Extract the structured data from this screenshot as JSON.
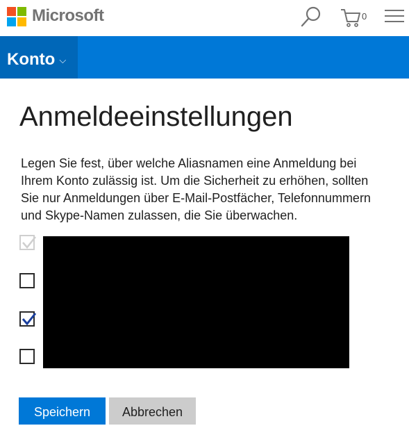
{
  "header": {
    "brand": "Microsoft",
    "cart_count": "0",
    "icons": {
      "search": "search-icon",
      "cart": "cart-icon",
      "menu": "hamburger-menu-icon"
    }
  },
  "nav": {
    "account_label": "Konto",
    "account_chevron": "⌵"
  },
  "main": {
    "title": "Anmeldeeinstellungen",
    "description": "Legen Sie fest, über welche Aliasnamen eine Anmeldung bei Ihrem Konto zulässig ist. Um die Sicherheit zu erhöhen, sollten Sie nur Anmeldungen über E-Mail-Postfächer, Telefonnummern und Skype-Namen zulassen, die Sie überwachen.",
    "aliases": [
      {
        "checked": true,
        "disabled": true
      },
      {
        "checked": false,
        "disabled": false
      },
      {
        "checked": true,
        "disabled": false
      },
      {
        "checked": false,
        "disabled": false
      }
    ],
    "save_label": "Speichern",
    "cancel_label": "Abbrechen"
  },
  "colors": {
    "accent": "#0078d7",
    "accent_dark": "#0067b8",
    "cancel_bg": "#cccccc"
  }
}
